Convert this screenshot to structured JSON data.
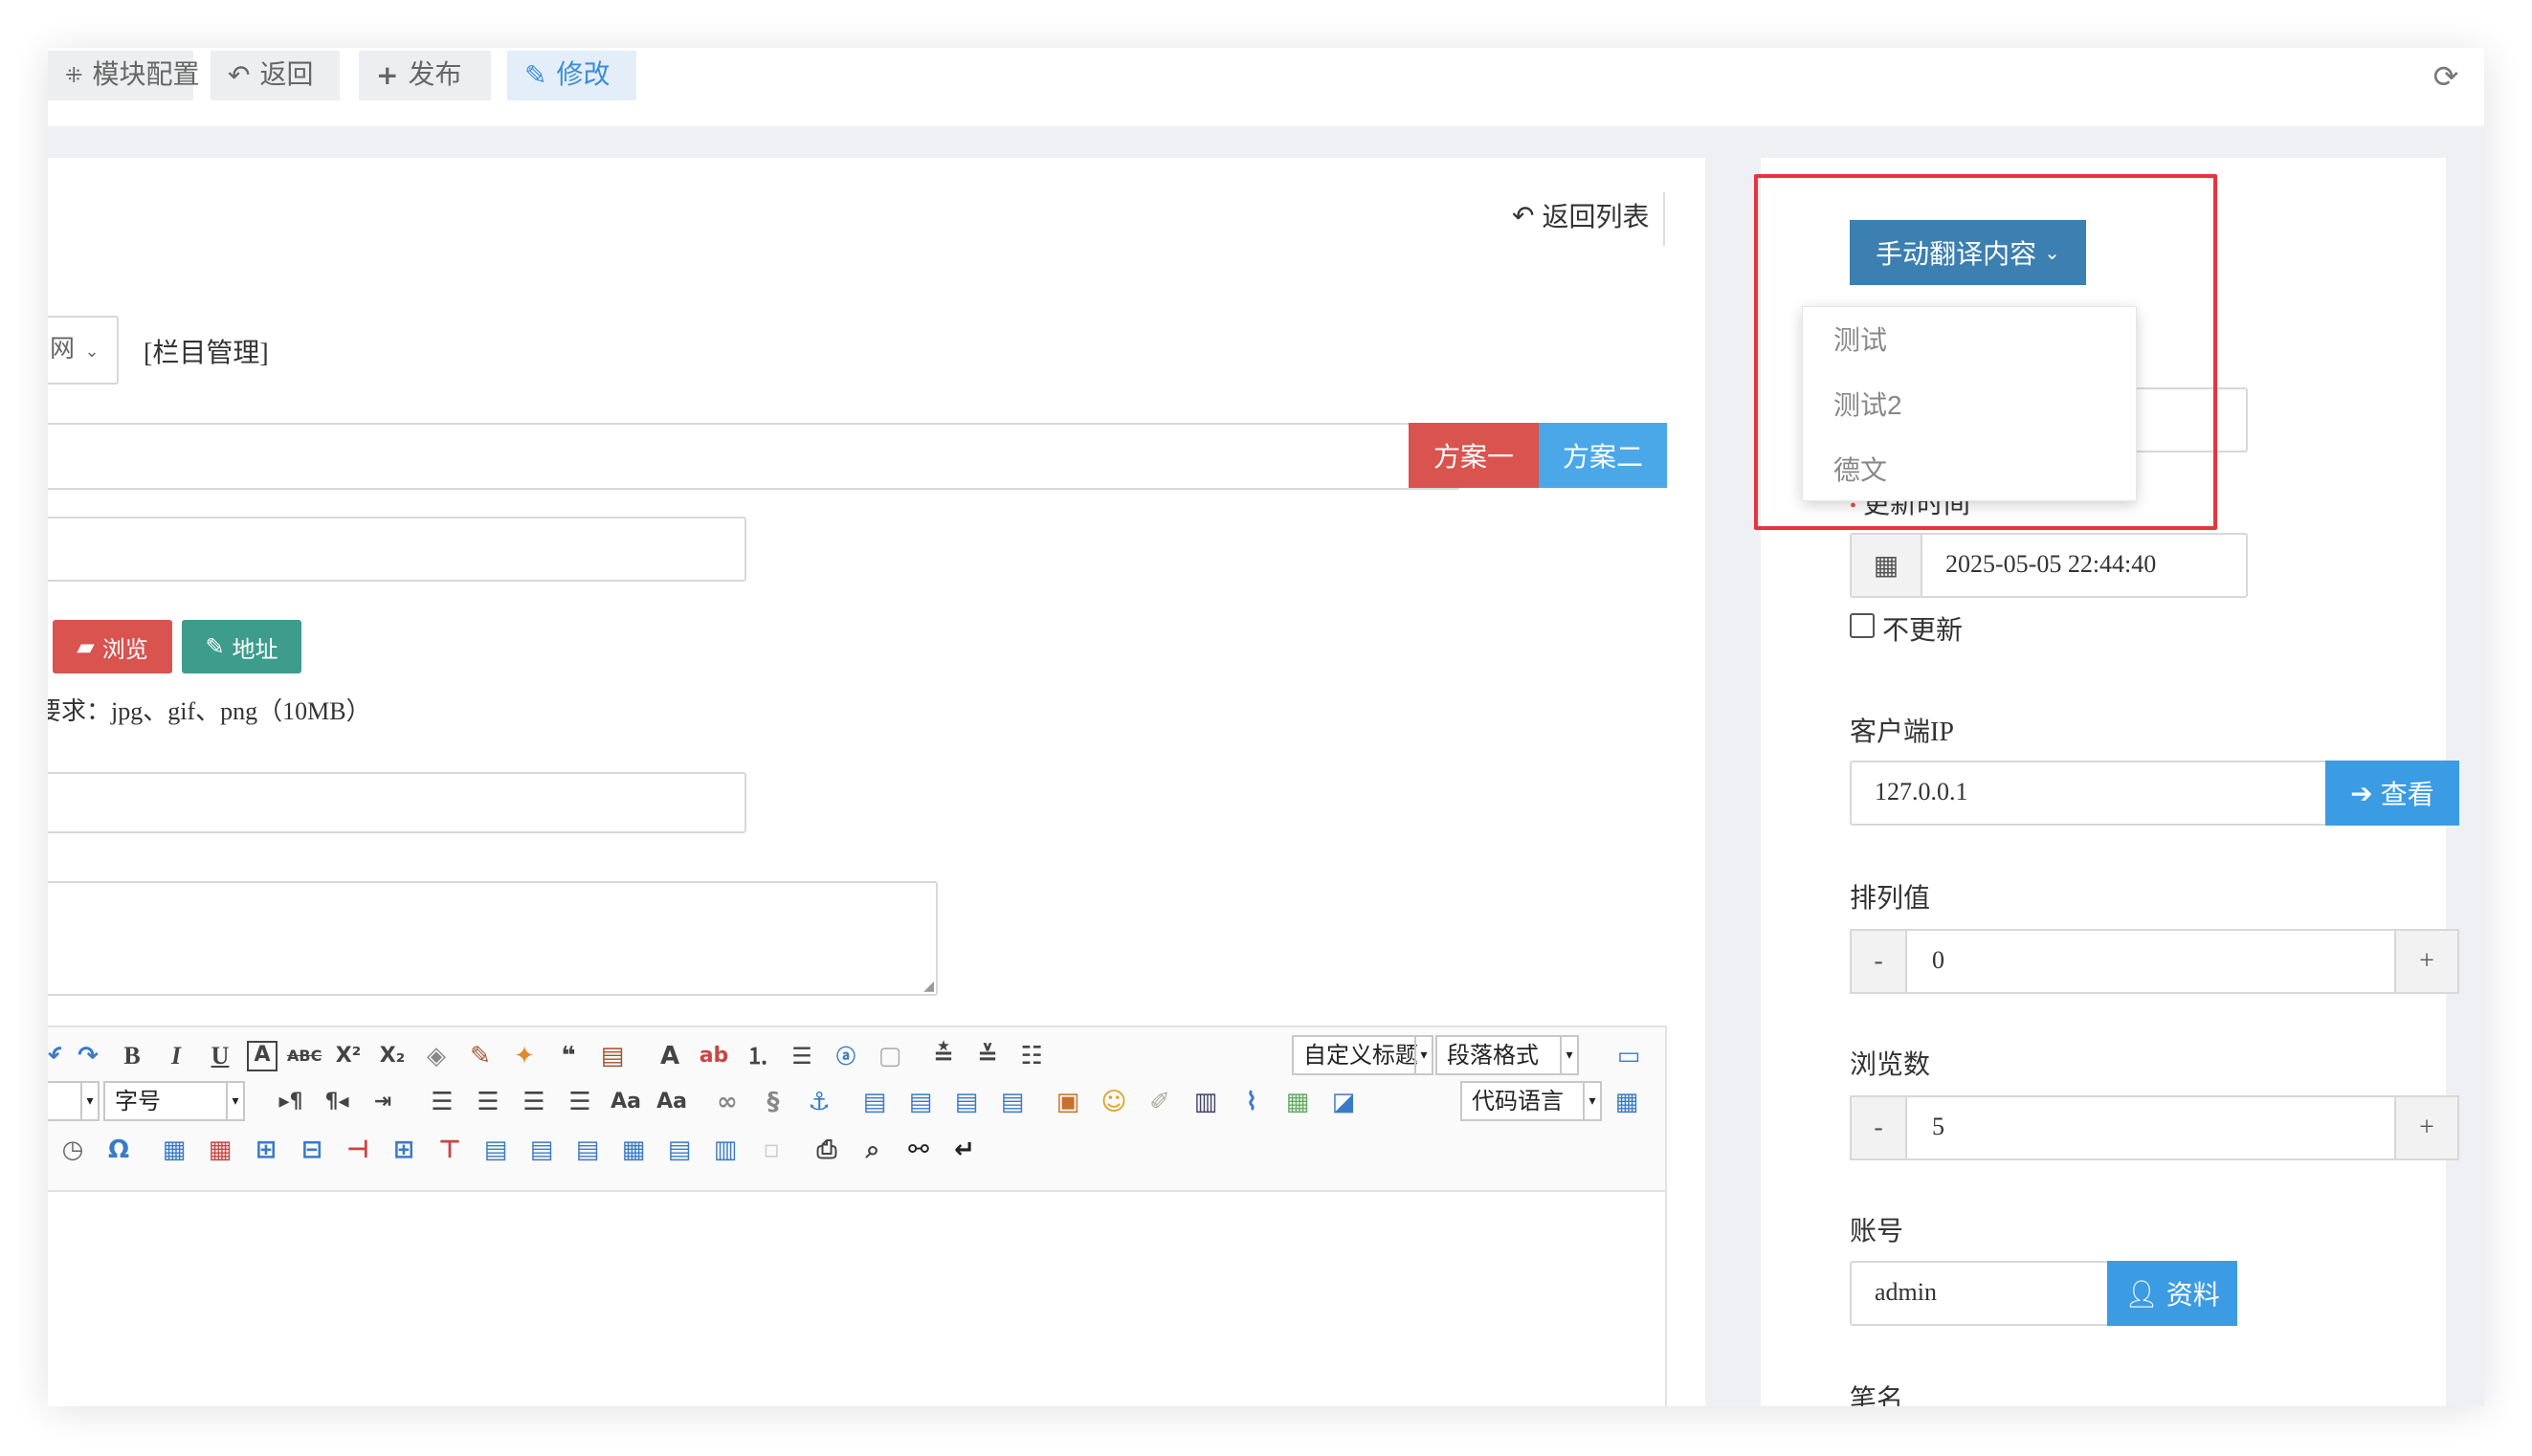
{
  "topbar": {
    "buttons": [
      {
        "icon": "cube-icon",
        "label": "模块配置"
      },
      {
        "icon": "undo-icon",
        "label": "返回"
      },
      {
        "icon": "plus-icon",
        "label": "发布"
      },
      {
        "icon": "edit-icon",
        "label": "修改"
      }
    ],
    "refresh_icon": "refresh-icon"
  },
  "left": {
    "back_to_list": "返回列表",
    "site_select": "网",
    "category_manage": "[栏目管理]",
    "title_buttons": {
      "plan1": "方案一",
      "plan2": "方案二"
    },
    "upload_buttons": {
      "browse": "浏览",
      "address": "地址"
    },
    "image_hint": "要求：jpg、gif、png（10MB）",
    "editor": {
      "font_size_placeholder": "字号",
      "custom_title": "自定义标题",
      "paragraph_format": "段落格式",
      "code_language": "代码语言"
    }
  },
  "right": {
    "translate_button": "手动翻译内容",
    "translate_options": [
      "测试",
      "测试2",
      "德文"
    ],
    "update_time_label": "更新时间",
    "update_time_value": "2025-05-05 22:44:40",
    "no_update_label": "不更新",
    "client_ip_label": "客户端IP",
    "client_ip_value": "127.0.0.1",
    "view_button": "查看",
    "sort_label": "排列值",
    "sort_value": "0",
    "views_label": "浏览数",
    "views_value": "5",
    "account_label": "账号",
    "account_value": "admin",
    "profile_button": "资料",
    "author_label": "笔名",
    "stepper_minus": "-",
    "stepper_plus": "+"
  },
  "colors": {
    "danger": "#d9534f",
    "info": "#4aa8e8",
    "teal": "#3d9c8c",
    "steel": "#3c7fb1",
    "highlight": "#e8343c"
  }
}
